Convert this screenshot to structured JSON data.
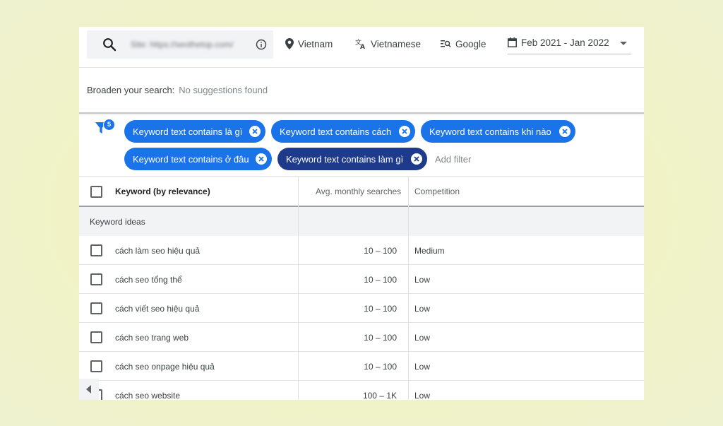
{
  "search": {
    "site_value": "Site: https://seothetop.com/",
    "search_icon": "search-icon",
    "info_icon": "info-icon"
  },
  "options": {
    "location": "Vietnam",
    "language": "Vietnamese",
    "network": "Google",
    "date_range": "Feb 2021 - Jan 2022"
  },
  "broaden": {
    "label": "Broaden your search:",
    "value": "No suggestions found"
  },
  "filters": {
    "count": "5",
    "chips": [
      "Keyword text contains là gì",
      "Keyword text contains cách",
      "Keyword text contains khi nào",
      "Keyword text contains ở đâu",
      "Keyword text contains làm gì"
    ],
    "add_label": "Add filter"
  },
  "table": {
    "headers": {
      "keyword": "Keyword (by relevance)",
      "avg": "Avg. monthly searches",
      "competition": "Competition"
    },
    "section": "Keyword ideas",
    "rows": [
      {
        "keyword": "cách làm seo hiệu quả",
        "avg": "10 – 100",
        "competition": "Medium"
      },
      {
        "keyword": "cách seo tổng thể",
        "avg": "10 – 100",
        "competition": "Low"
      },
      {
        "keyword": "cách viết seo hiệu quả",
        "avg": "10 – 100",
        "competition": "Low"
      },
      {
        "keyword": "cách seo trang web",
        "avg": "10 – 100",
        "competition": "Low"
      },
      {
        "keyword": "cách seo onpage hiệu quả",
        "avg": "10 – 100",
        "competition": "Low"
      },
      {
        "keyword": "cách seo website",
        "avg": "100 – 1K",
        "competition": "Low"
      }
    ]
  },
  "colors": {
    "chip": "#1a73e8",
    "chip_active": "#1e3a8a",
    "background": "#f1f3c6"
  }
}
